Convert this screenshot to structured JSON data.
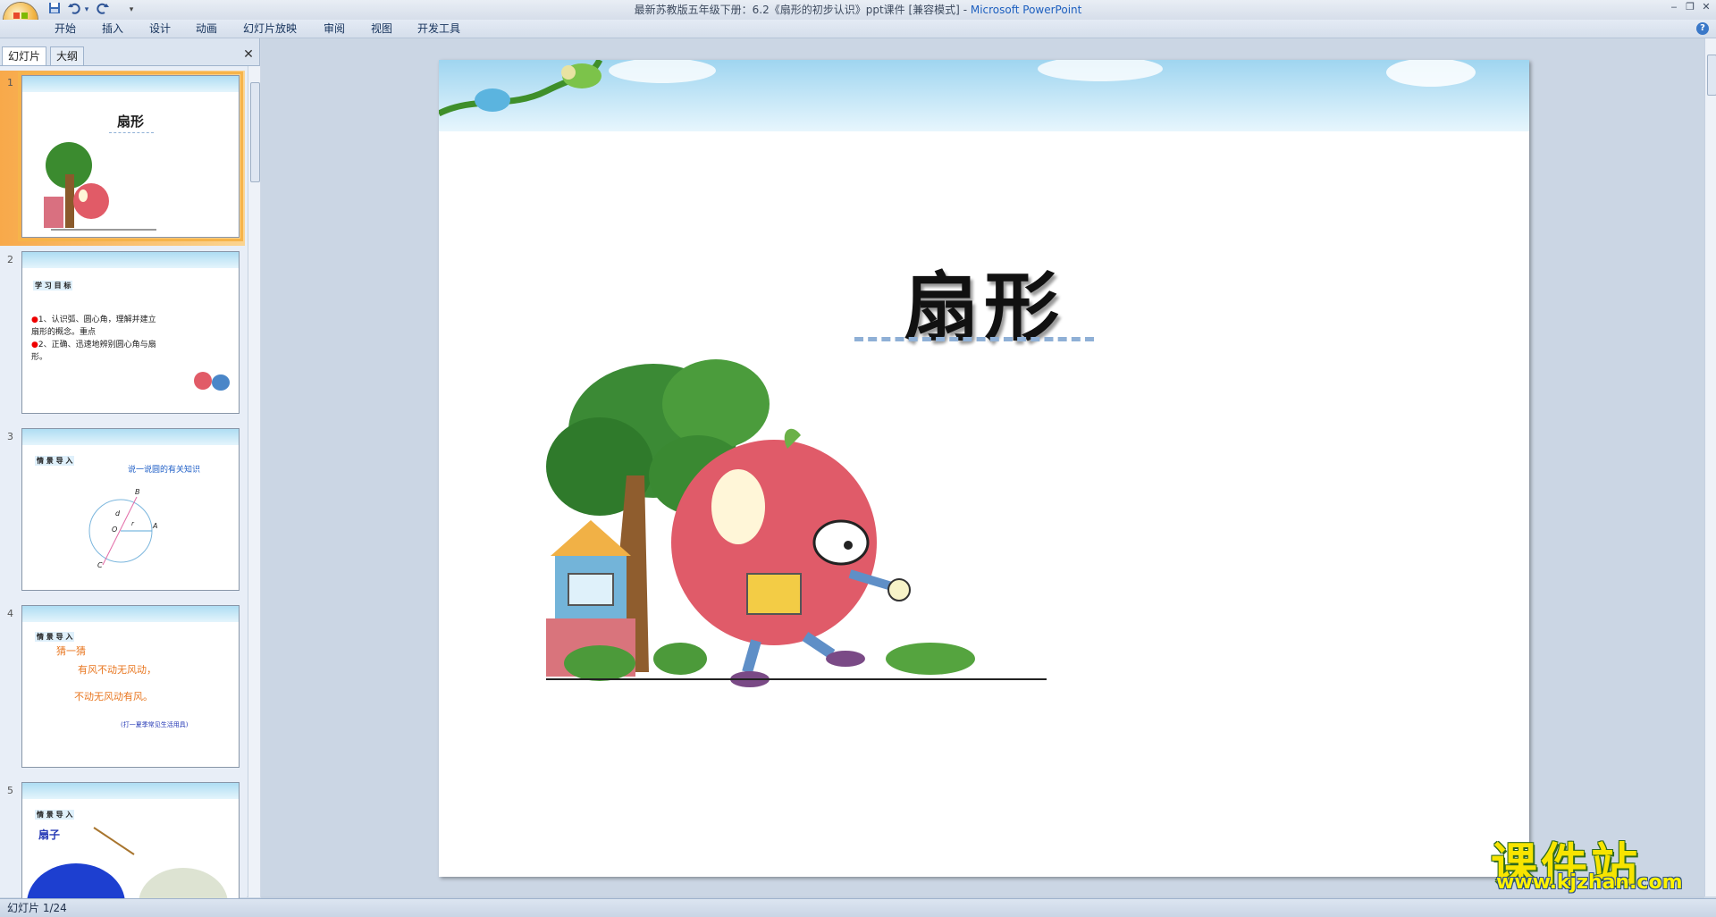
{
  "window": {
    "title_doc": "最新苏教版五年级下册：6.2《扇形的初步认识》ppt课件 [兼容模式]",
    "title_sep": " - ",
    "title_app": "Microsoft PowerPoint",
    "minimize": "‒",
    "maximize": "❐",
    "close": "✕"
  },
  "quick_access": {
    "save_icon": "save-icon",
    "undo_icon": "undo-icon",
    "redo_icon": "redo-icon",
    "customize": "▾"
  },
  "ribbon": {
    "tabs": [
      "开始",
      "插入",
      "设计",
      "动画",
      "幻灯片放映",
      "审阅",
      "视图",
      "开发工具"
    ],
    "help": "?"
  },
  "left_panel": {
    "tabs": [
      "幻灯片",
      "大纲"
    ],
    "close": "✕",
    "thumbnails": [
      {
        "num": "1",
        "title": "扇形"
      },
      {
        "num": "2",
        "heading": "学 习 目 标",
        "lines": [
          "1、认识弧、圆心角，理解并建立",
          "扇形的概念。重点",
          "2、正确、迅速地辨别圆心角与扇",
          "形。"
        ]
      },
      {
        "num": "3",
        "heading": "情 景 导 入",
        "subtitle": "说一说圆的有关知识",
        "labels": [
          "B",
          "d",
          "O",
          "r",
          "A",
          "C"
        ]
      },
      {
        "num": "4",
        "heading": "情 景 导 入",
        "lines": [
          "猜一猜",
          "有风不动无风动，",
          "不动无风动有风。",
          "(打一夏季常见生活用具)"
        ]
      },
      {
        "num": "5",
        "heading": "情 景 导 入",
        "lines": [
          "扇子"
        ]
      }
    ],
    "selected": 1
  },
  "slide": {
    "title": "扇形"
  },
  "status": {
    "text": "幻灯片 1/24"
  },
  "watermark": {
    "brand": "课件站",
    "url": "www.kjzhan.com"
  }
}
